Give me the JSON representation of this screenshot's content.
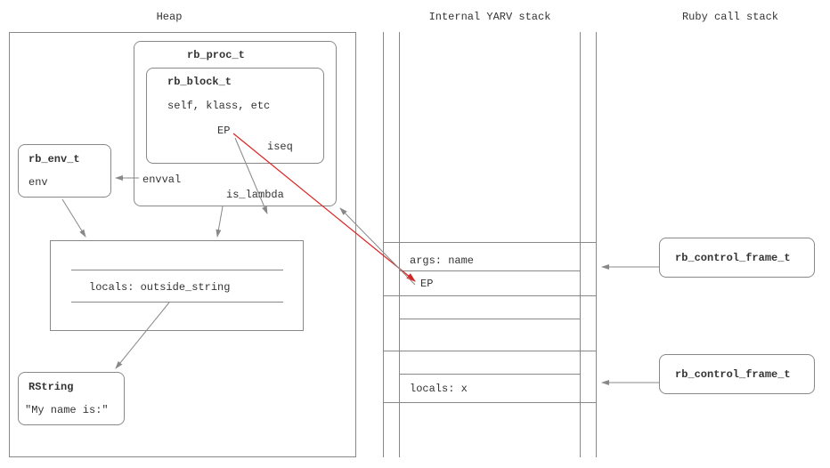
{
  "titles": {
    "heap": "Heap",
    "yarv": "Internal YARV stack",
    "ruby": "Ruby call stack"
  },
  "proc": {
    "title": "rb_proc_t",
    "block": {
      "title": "rb_block_t",
      "fields": "self, klass, etc",
      "ep": "EP",
      "iseq": "iseq"
    },
    "envval": "envval",
    "is_lambda": "is_lambda"
  },
  "env": {
    "title": "rb_env_t",
    "field": "env"
  },
  "locals_box": {
    "label": "locals: outside_string"
  },
  "rstring": {
    "title": "RString",
    "value": "\"My name is:\""
  },
  "stack1": {
    "args": "args: name",
    "ep": "EP"
  },
  "stack2": {
    "locals": "locals: x"
  },
  "cframe": "rb_control_frame_t"
}
